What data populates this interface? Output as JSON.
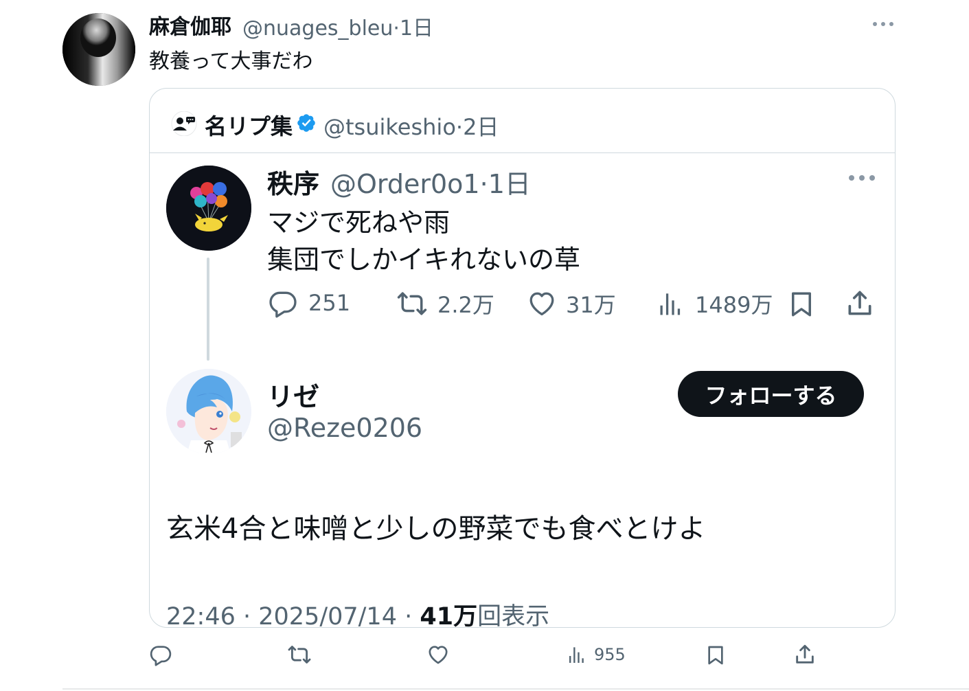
{
  "outer_tweet": {
    "display_name": "麻倉伽耶",
    "handle": "@nuages_bleu",
    "separator": "·",
    "time": "1日",
    "text": "教養って大事だわ",
    "actions": {
      "views": "955"
    }
  },
  "quote": {
    "display_name": "名リプ集",
    "handle": "@tsuikeshio",
    "separator": "·",
    "time": "2日",
    "verified": true,
    "original_post": {
      "display_name": "秩序",
      "handle": "@Order0o1",
      "separator": "·",
      "time": "1日",
      "line1": "マジで死ねや雨",
      "line2": "集団でしかイキれないの草",
      "stats": {
        "replies": "251",
        "reposts": "2.2万",
        "likes": "31万",
        "views": "1489万"
      }
    },
    "reply_post": {
      "display_name": "リゼ",
      "handle": "@Reze0206",
      "follow_label": "フォローする",
      "text": "玄米4合と味噌と少しの野菜でも食べとけよ",
      "footer_time": "22:46 · 2025/07/14 · ",
      "footer_views_count": "41万",
      "footer_views_label": "回表示"
    }
  },
  "colors": {
    "text_primary": "#0f1419",
    "text_secondary": "#536471",
    "border": "#cfd9de",
    "verified_blue": "#1d9bf0",
    "follow_button": "#0f1419"
  },
  "icons": [
    "reply-icon",
    "repost-icon",
    "like-icon",
    "views-icon",
    "bookmark-icon",
    "share-icon",
    "more-icon",
    "verified-badge-icon",
    "community-icon"
  ]
}
